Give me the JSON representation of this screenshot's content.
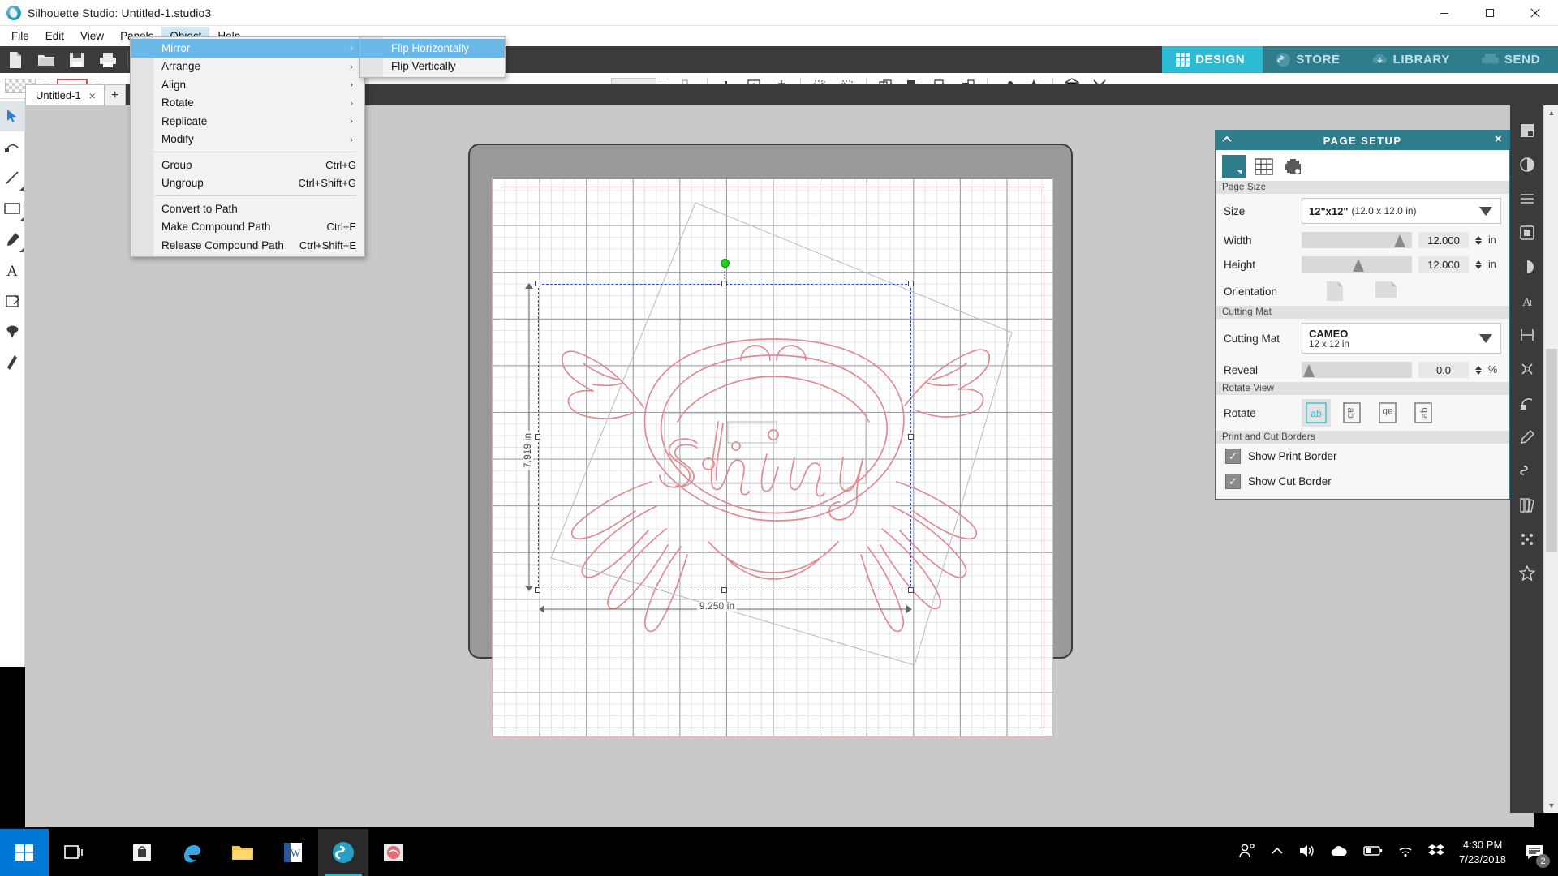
{
  "window": {
    "title": "Silhouette Studio: Untitled-1.studio3",
    "app_icon": "silhouette-logo-icon",
    "minimize": "minimize-icon",
    "maximize": "maximize-icon",
    "close": "close-icon"
  },
  "menubar": {
    "items": [
      {
        "label": "File",
        "active": false
      },
      {
        "label": "Edit",
        "active": false
      },
      {
        "label": "View",
        "active": false
      },
      {
        "label": "Panels",
        "active": false
      },
      {
        "label": "Object",
        "active": true
      },
      {
        "label": "Help",
        "active": false
      }
    ]
  },
  "object_menu": {
    "items": [
      {
        "label": "Mirror",
        "accel": "",
        "submenu": true,
        "highlighted": true
      },
      {
        "label": "Arrange",
        "accel": "",
        "submenu": true,
        "highlighted": false
      },
      {
        "label": "Align",
        "accel": "",
        "submenu": true,
        "highlighted": false
      },
      {
        "label": "Rotate",
        "accel": "",
        "submenu": true,
        "highlighted": false
      },
      {
        "label": "Replicate",
        "accel": "",
        "submenu": true,
        "highlighted": false
      },
      {
        "label": "Modify",
        "accel": "",
        "submenu": true,
        "highlighted": false
      },
      {
        "separator": true
      },
      {
        "label": "Group",
        "accel": "Ctrl+G",
        "submenu": false,
        "highlighted": false
      },
      {
        "label": "Ungroup",
        "accel": "Ctrl+Shift+G",
        "submenu": false,
        "highlighted": false
      },
      {
        "separator": true
      },
      {
        "label": "Convert to Path",
        "accel": "",
        "submenu": false,
        "highlighted": false
      },
      {
        "label": "Make Compound Path",
        "accel": "Ctrl+E",
        "submenu": false,
        "highlighted": false
      },
      {
        "label": "Release Compound Path",
        "accel": "Ctrl+Shift+E",
        "submenu": false,
        "highlighted": false
      }
    ]
  },
  "mirror_submenu": {
    "items": [
      {
        "label": "Flip Horizontally",
        "highlighted": true
      },
      {
        "label": "Flip Vertically",
        "highlighted": false
      }
    ]
  },
  "toolbar_dark": {
    "icons": [
      "new-document-icon",
      "open-folder-icon",
      "save-icon",
      "print-icon",
      "cut-scissors-icon",
      "copy-icon",
      "paste-icon",
      "undo-icon",
      "redo-icon"
    ]
  },
  "toolbar_light": {
    "fill_swatch": "fill-swatch-icon",
    "stroke_swatch": "stroke-color-swatch",
    "line_style": "line-style-preview",
    "line_width_value": "",
    "unit_label": "in",
    "icons": [
      "text-style-icon",
      "bar-chart-icon",
      "fit-to-page-icon",
      "align-center-icon",
      "trace-icon",
      "trace-outline-icon",
      "duplicate-icon",
      "arrange-front-icon",
      "arrange-back-icon",
      "arrange-forward-icon",
      "weld-icon",
      "star-effect-icon",
      "3d-box-icon",
      "close-x-icon"
    ]
  },
  "right_tabs": {
    "items": [
      {
        "label": "DESIGN",
        "icon": "grid-icon",
        "active": true
      },
      {
        "label": "STORE",
        "icon": "store-icon",
        "active": false
      },
      {
        "label": "LIBRARY",
        "icon": "cloud-download-icon",
        "active": false
      },
      {
        "label": "SEND",
        "icon": "cutting-machine-icon",
        "active": false
      }
    ]
  },
  "left_tools": {
    "items": [
      {
        "name": "select-tool",
        "active": true
      },
      {
        "name": "edit-points-tool",
        "active": false
      },
      {
        "name": "line-tool",
        "active": false
      },
      {
        "name": "rectangle-tool",
        "active": false
      },
      {
        "name": "draw-pencil-tool",
        "active": false
      },
      {
        "name": "text-tool",
        "active": false
      },
      {
        "name": "notes-tool",
        "active": false
      },
      {
        "name": "eraser-tool",
        "active": false
      },
      {
        "name": "knife-tool",
        "active": false
      }
    ]
  },
  "document_tabs": {
    "tabs": [
      {
        "label": "Untitled-1",
        "close": "×"
      }
    ],
    "new_tab": "+"
  },
  "canvas": {
    "design_text": "Shiny",
    "width_dimension": "9.250 in",
    "height_dimension": "7.919 in",
    "mat_label": "cutting-mat"
  },
  "panel": {
    "title": "PAGE SETUP",
    "collapse_icon": "chevron-up-icon",
    "close_icon": "close-icon",
    "tabs": [
      {
        "name": "page-tab",
        "active": true
      },
      {
        "name": "grid-tab",
        "active": false
      },
      {
        "name": "registration-tab",
        "active": false
      }
    ],
    "page_size": {
      "section": "Page Size",
      "size_label": "Size",
      "size_value": "12\"x12\"",
      "size_detail": "(12.0 x 12.0 in)",
      "width_label": "Width",
      "width_value": "12.000",
      "width_unit": "in",
      "height_label": "Height",
      "height_value": "12.000",
      "height_unit": "in",
      "orientation_label": "Orientation"
    },
    "cutting_mat": {
      "section": "Cutting Mat",
      "mat_label": "Cutting Mat",
      "mat_value": "CAMEO",
      "mat_detail": "12 x 12 in",
      "reveal_label": "Reveal",
      "reveal_value": "0.0",
      "reveal_unit": "%"
    },
    "rotate_view": {
      "section": "Rotate View",
      "rotate_label": "Rotate",
      "options": [
        {
          "glyph": "ab",
          "rot": 0,
          "active": true
        },
        {
          "glyph": "ab",
          "rot": 90,
          "active": false
        },
        {
          "glyph": "ab",
          "rot": 180,
          "active": false
        },
        {
          "glyph": "ab",
          "rot": 270,
          "active": false
        }
      ]
    },
    "borders": {
      "section": "Print and Cut Borders",
      "show_print_border": "Show Print Border",
      "show_print_border_checked": true,
      "show_cut_border": "Show Cut Border",
      "show_cut_border_checked": true
    }
  },
  "right_rail": {
    "icons": [
      "page-setup-icon",
      "fill-color-icon",
      "line-style-icon",
      "line-color-icon",
      "gradient-fill-icon",
      "text-style-icon",
      "transform-icon",
      "modify-icon",
      "offset-icon",
      "sketch-icon",
      "store-rail-icon",
      "library-rail-icon",
      "design-rail-icon",
      "favorites-icon"
    ]
  },
  "taskbar": {
    "start_icon": "windows-start-icon",
    "task_view_icon": "task-view-icon",
    "apps": [
      {
        "name": "store-app-icon",
        "active": false
      },
      {
        "name": "edge-browser-icon",
        "active": false
      },
      {
        "name": "file-explorer-icon",
        "active": false
      },
      {
        "name": "word-app-icon",
        "active": false
      },
      {
        "name": "silhouette-studio-app-icon",
        "active": true
      },
      {
        "name": "silhouette-second-window-icon",
        "active": false
      }
    ],
    "tray": [
      "people-icon",
      "show-hidden-icons-icon",
      "volume-icon",
      "onedrive-icon",
      "battery-icon",
      "wifi-icon",
      "dropbox-icon"
    ],
    "time": "4:30 PM",
    "date": "7/23/2018",
    "notification_count": "2"
  },
  "colors": {
    "accent_teal": "#2bbcd4",
    "panel_header": "#2f7d8c",
    "menu_highlight": "#6cb8e8",
    "design_stroke": "#e08a90",
    "selection_blue": "#2f49c9",
    "rotate_handle_green": "#17d417"
  }
}
